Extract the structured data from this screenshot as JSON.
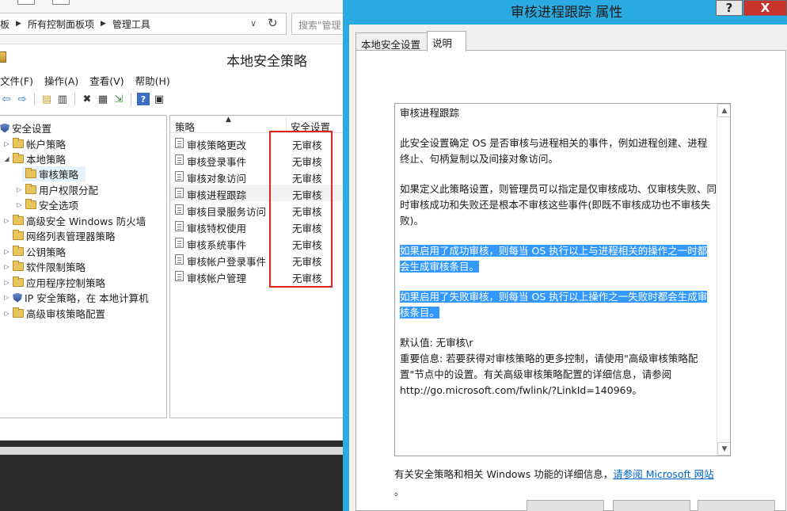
{
  "explorer": {
    "breadcrumb": [
      "板",
      "所有控制面板项",
      "管理工具"
    ],
    "search_placeholder": "搜索\"管理"
  },
  "lsp": {
    "title": "本地安全策略",
    "menu": [
      "文件(F)",
      "操作(A)",
      "查看(V)",
      "帮助(H)"
    ],
    "tree": [
      {
        "label": "安全设置",
        "level": 0,
        "expander": "none",
        "icon": "shield-icon"
      },
      {
        "label": "帐户策略",
        "level": 1,
        "expander": "collapsed",
        "icon": "folder-icon"
      },
      {
        "label": "本地策略",
        "level": 1,
        "expander": "expanded",
        "icon": "folder-icon"
      },
      {
        "label": "审核策略",
        "level": 2,
        "expander": "none",
        "icon": "folder-icon",
        "selected": true
      },
      {
        "label": "用户权限分配",
        "level": 2,
        "expander": "collapsed",
        "icon": "folder-icon"
      },
      {
        "label": "安全选项",
        "level": 2,
        "expander": "collapsed",
        "icon": "folder-icon"
      },
      {
        "label": "高级安全 Windows 防火墙",
        "level": 1,
        "expander": "collapsed",
        "icon": "folder-icon"
      },
      {
        "label": "网络列表管理器策略",
        "level": 1,
        "expander": "none",
        "icon": "folder-icon"
      },
      {
        "label": "公钥策略",
        "level": 1,
        "expander": "collapsed",
        "icon": "folder-icon"
      },
      {
        "label": "软件限制策略",
        "level": 1,
        "expander": "collapsed",
        "icon": "folder-icon"
      },
      {
        "label": "应用程序控制策略",
        "level": 1,
        "expander": "collapsed",
        "icon": "folder-icon"
      },
      {
        "label": "IP 安全策略，在 本地计算机",
        "level": 1,
        "expander": "collapsed",
        "icon": "shield-icon"
      },
      {
        "label": "高级审核策略配置",
        "level": 1,
        "expander": "collapsed",
        "icon": "folder-icon"
      }
    ],
    "list_headers": {
      "policy": "策略",
      "setting": "安全设置"
    },
    "policies": [
      {
        "name": "审核策略更改",
        "setting": "无审核"
      },
      {
        "name": "审核登录事件",
        "setting": "无审核"
      },
      {
        "name": "审核对象访问",
        "setting": "无审核"
      },
      {
        "name": "审核进程跟踪",
        "setting": "无审核",
        "selected": true
      },
      {
        "name": "审核目录服务访问",
        "setting": "无审核"
      },
      {
        "name": "审核特权使用",
        "setting": "无审核"
      },
      {
        "name": "审核系统事件",
        "setting": "无审核"
      },
      {
        "name": "审核帐户登录事件",
        "setting": "无审核"
      },
      {
        "name": "审核帐户管理",
        "setting": "无审核"
      }
    ]
  },
  "dialog": {
    "title": "审核进程跟踪 属性",
    "help_label": "?",
    "close_label": "X",
    "tabs": [
      "本地安全设置",
      "说明"
    ],
    "explain": {
      "heading": "审核进程跟踪",
      "para1": "此安全设置确定 OS 是否审核与进程相关的事件，例如进程创建、进程终止、句柄复制以及间接对象访问。",
      "para2": "如果定义此策略设置，则管理员可以指定是仅审核成功、仅审核失败、同时审核成功和失败还是根本不审核这些事件(即既不审核成功也不审核失败)。",
      "para3": "如果启用了成功审核，则每当 OS 执行以上与进程相关的操作之一时都会生成审核条目。",
      "para4": "如果启用了失败审核，则每当 OS 执行以上操作之一失败时都会生成审核条目。",
      "default_value": "默认值: 无审核\\r",
      "important": "重要信息: 若要获得对审核策略的更多控制，请使用\"高级审核策略配置\"节点中的设置。有关高级审核策略配置的详细信息，请参阅 http://go.microsoft.com/fwlink/?LinkId=140969。"
    },
    "footer_text": "有关安全策略和相关 Windows 功能的详细信息，",
    "footer_link": "请参阅 Microsoft 网站",
    "footer_end": "。"
  },
  "colors": {
    "dialog_frame": "#29abe2",
    "highlight": "#3399ff",
    "annotation_box": "#e2231a",
    "close_button": "#c7322c"
  }
}
